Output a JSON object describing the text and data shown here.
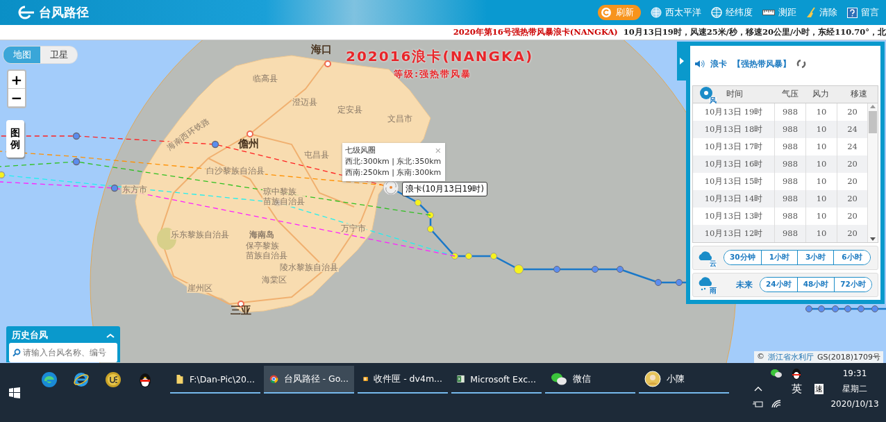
{
  "header": {
    "title": "台风路径",
    "refresh": "刷新",
    "tools": [
      {
        "label": "西太平洋",
        "kind": "globe"
      },
      {
        "label": "经纬度",
        "kind": "grid"
      },
      {
        "label": "测距",
        "kind": "ruler"
      },
      {
        "label": "清除",
        "kind": "broom"
      },
      {
        "label": "留言",
        "kind": "help"
      }
    ]
  },
  "ticker": {
    "headline": "2020年第16号强热带风暴浪卡(NANGKA)",
    "text": "10月13日19时，风速25米/秒，移速20公里/小时，东经110.70°，北"
  },
  "map": {
    "layer_tabs": [
      {
        "label": "地图",
        "selected": true
      },
      {
        "label": "卫星",
        "selected": false
      }
    ],
    "zoom": [
      "+",
      "−"
    ],
    "legend": "图例",
    "title": "202016浪卡(NANGKA)",
    "subtitle": "等级:强热带风暴",
    "places": [
      {
        "kind": "city",
        "lines": [
          "海口"
        ]
      },
      {
        "kind": "county",
        "lines": [
          "临高县"
        ]
      },
      {
        "kind": "county",
        "lines": [
          "澄迈县"
        ]
      },
      {
        "kind": "county",
        "lines": [
          "定安县"
        ]
      },
      {
        "kind": "county",
        "lines": [
          "文昌市"
        ]
      },
      {
        "kind": "city",
        "lines": [
          "儋州"
        ]
      },
      {
        "kind": "county",
        "lines": [
          "屯昌县"
        ]
      },
      {
        "kind": "county",
        "lines": [
          "白沙黎族自治县"
        ]
      },
      {
        "kind": "county",
        "lines": [
          "东方市"
        ]
      },
      {
        "kind": "county",
        "lines": [
          "琼中黎族",
          "苗族自治县"
        ]
      },
      {
        "kind": "county",
        "lines": [
          "万宁市"
        ]
      },
      {
        "kind": "county",
        "lines": [
          "乐东黎族自治县"
        ]
      },
      {
        "kind": "island",
        "lines": [
          "海南岛"
        ]
      },
      {
        "kind": "county",
        "lines": [
          "保亭黎族",
          "苗族自治县"
        ]
      },
      {
        "kind": "county",
        "lines": [
          "陵水黎族自治县"
        ]
      },
      {
        "kind": "county",
        "lines": [
          "海棠区"
        ]
      },
      {
        "kind": "county",
        "lines": [
          "崖州区"
        ]
      },
      {
        "kind": "city",
        "lines": [
          "三亚"
        ]
      },
      {
        "kind": "railway",
        "lines": [
          "海南西环铁路"
        ]
      }
    ],
    "popup": {
      "title": "七级风圈",
      "close": "×",
      "lines": [
        "西北:300km | 东北:350km",
        "西南:250km | 东南:300km"
      ]
    },
    "storm_label": "浪卡(10月13日19时)",
    "history": {
      "title": "历史台风",
      "placeholder": "请输入台风名称、编号"
    },
    "attribution": {
      "symbol": "©",
      "source": "浙江省水利厅",
      "license": "GS(2018)1709号"
    }
  },
  "panel": {
    "name": "浪卡",
    "level": "【强热带风暴】",
    "wind_badge": "风",
    "columns": [
      "时间",
      "气压",
      "风力",
      "移速"
    ],
    "rows": [
      [
        "10月13日 19时",
        "988",
        "10",
        "20"
      ],
      [
        "10月13日 18时",
        "988",
        "10",
        "24"
      ],
      [
        "10月13日 17时",
        "988",
        "10",
        "24"
      ],
      [
        "10月13日 16时",
        "988",
        "10",
        "20"
      ],
      [
        "10月13日 15时",
        "988",
        "10",
        "20"
      ],
      [
        "10月13日 14时",
        "988",
        "10",
        "20"
      ],
      [
        "10月13日 13时",
        "988",
        "10",
        "20"
      ],
      [
        "10月13日 12时",
        "988",
        "10",
        "20"
      ]
    ],
    "cloud": {
      "badge": "云",
      "options": [
        "30分钟",
        "1小时",
        "3小时",
        "6小时"
      ]
    },
    "rain": {
      "badge": "雨",
      "label": "未来",
      "options": [
        "24小时",
        "48小时",
        "72小时"
      ]
    }
  },
  "taskbar": {
    "pinned": [
      {
        "kind": "edge"
      },
      {
        "kind": "ie"
      },
      {
        "kind": "ue"
      },
      {
        "kind": "qq"
      }
    ],
    "windows": [
      {
        "label": "F:\\Dan-Pic\\20...",
        "kind": "folder",
        "selected": false
      },
      {
        "label": "台风路径 - Go...",
        "kind": "chrome",
        "selected": true
      },
      {
        "label": "收件匣 - dv4m...",
        "kind": "mail",
        "selected": false
      },
      {
        "label": "Microsoft Exc...",
        "kind": "excel",
        "selected": false
      },
      {
        "label": "微信",
        "kind": "wechat",
        "selected": false
      },
      {
        "label": "小陳",
        "kind": "avatar",
        "selected": false
      }
    ],
    "ime": "英",
    "speed": "速",
    "time": "19:31",
    "weekday": "星期二",
    "date": "2020/10/13"
  }
}
